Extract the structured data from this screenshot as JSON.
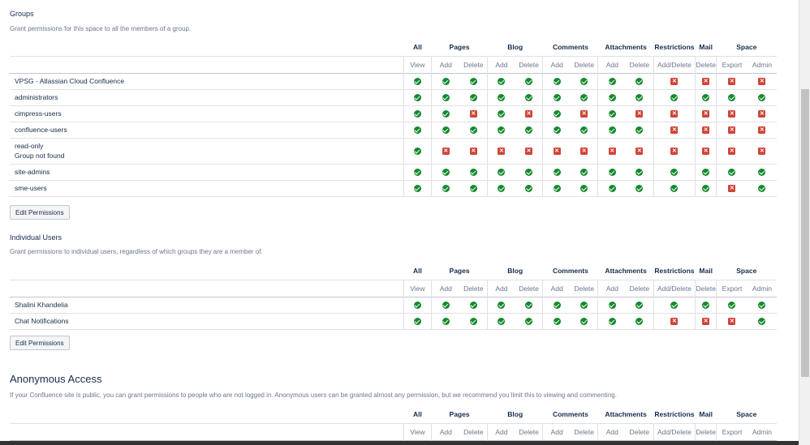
{
  "groups": {
    "title": "Groups",
    "description": "Grant permissions for this space to all the members of a group.",
    "button": "Edit Permissions",
    "rows": [
      {
        "name": "VPSG - Atlassian Cloud Confluence",
        "perms": [
          1,
          1,
          1,
          1,
          1,
          1,
          1,
          1,
          1,
          0,
          0,
          0,
          0
        ]
      },
      {
        "name": "administrators",
        "perms": [
          1,
          1,
          1,
          1,
          1,
          1,
          1,
          1,
          1,
          1,
          1,
          1,
          1
        ]
      },
      {
        "name": "cimpress-users",
        "perms": [
          1,
          1,
          0,
          1,
          0,
          1,
          0,
          1,
          0,
          0,
          0,
          0,
          0
        ]
      },
      {
        "name": "confluence-users",
        "perms": [
          1,
          1,
          1,
          1,
          1,
          1,
          1,
          1,
          1,
          0,
          0,
          0,
          0
        ]
      },
      {
        "name": "read-only",
        "sub": "Group not found",
        "perms": [
          1,
          0,
          0,
          0,
          0,
          0,
          0,
          0,
          0,
          0,
          0,
          0,
          0
        ]
      },
      {
        "name": "site-admins",
        "perms": [
          1,
          1,
          1,
          1,
          1,
          1,
          1,
          1,
          1,
          1,
          1,
          1,
          1
        ]
      },
      {
        "name": "sme-users",
        "perms": [
          1,
          1,
          1,
          1,
          1,
          1,
          1,
          1,
          1,
          1,
          1,
          0,
          1
        ]
      }
    ]
  },
  "individuals": {
    "title": "Individual Users",
    "description": "Grant permissions to individual users, regardless of which groups they are a member of.",
    "button": "Edit Permissions",
    "rows": [
      {
        "name": "Shalini Khandelia",
        "perms": [
          1,
          1,
          1,
          1,
          1,
          1,
          1,
          1,
          1,
          1,
          1,
          1,
          1
        ]
      },
      {
        "name": "Chat Notifications",
        "perms": [
          1,
          1,
          1,
          1,
          1,
          1,
          1,
          1,
          1,
          0,
          0,
          0,
          1
        ]
      }
    ]
  },
  "anonymous": {
    "title": "Anonymous Access",
    "description": "If your Confluence site is public, you can grant permissions to people who are not logged in. Anonymous users can be granted almost any permission, but we recommend you limit this to viewing and commenting."
  },
  "headers": {
    "groups": [
      {
        "label": "All",
        "span": 1
      },
      {
        "label": "Pages",
        "span": 2
      },
      {
        "label": "Blog",
        "span": 2
      },
      {
        "label": "Comments",
        "span": 2
      },
      {
        "label": "Attachments",
        "span": 2
      },
      {
        "label": "Restrictions",
        "span": 1
      },
      {
        "label": "Mail",
        "span": 1
      },
      {
        "label": "Space",
        "span": 2
      }
    ],
    "subs": [
      "View",
      "Add",
      "Delete",
      "Add",
      "Delete",
      "Add",
      "Delete",
      "Add",
      "Delete",
      "Add/Delete",
      "Delete",
      "Export",
      "Admin"
    ]
  },
  "colors": {
    "ok": "#14892c",
    "no": "#d04437"
  },
  "icons": {
    "ok": "check-circle-icon",
    "no": "cross-square-icon"
  }
}
